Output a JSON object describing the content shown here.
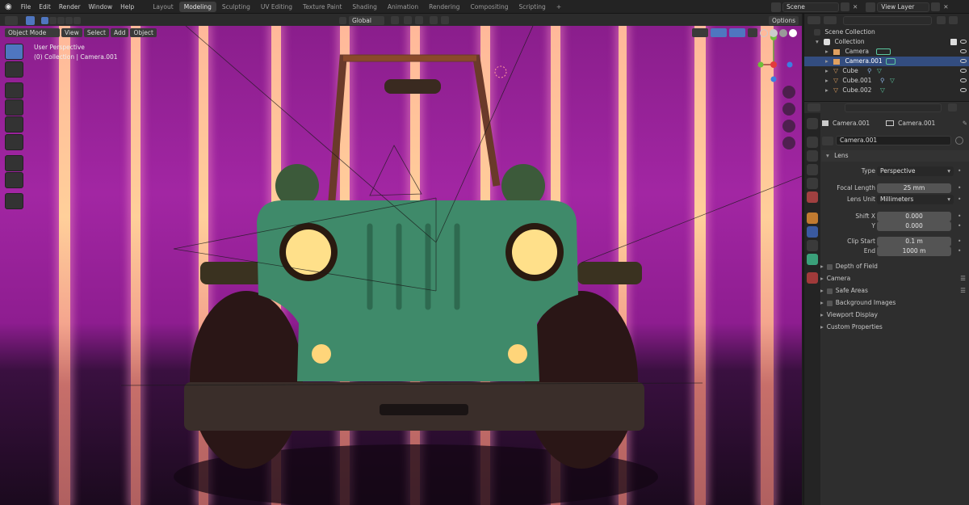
{
  "topbar": {
    "menus": [
      "File",
      "Edit",
      "Render",
      "Window",
      "Help"
    ],
    "workspaces": [
      "Layout",
      "Modeling",
      "Sculpting",
      "UV Editing",
      "Texture Paint",
      "Shading",
      "Animation",
      "Rendering",
      "Compositing",
      "Scripting"
    ],
    "active_workspace": "Modeling",
    "add_workspace": "+",
    "scene": "Scene",
    "view_layer": "View Layer"
  },
  "viewport": {
    "mode": "Object Mode",
    "menus": [
      "View",
      "Select",
      "Add",
      "Object"
    ],
    "orientation": "Global",
    "options": "Options",
    "overlay_title": "User Perspective",
    "overlay_subtitle": "(0) Collection | Camera.001"
  },
  "outliner": {
    "root": "Scene Collection",
    "collection": "Collection",
    "items": [
      {
        "name": "Camera",
        "icon": "camera-icon"
      },
      {
        "name": "Camera.001",
        "icon": "camera-icon",
        "selected": true
      },
      {
        "name": "Cube",
        "icon": "mesh-icon"
      },
      {
        "name": "Cube.001",
        "icon": "mesh-icon"
      },
      {
        "name": "Cube.002",
        "icon": "mesh-icon"
      }
    ]
  },
  "properties": {
    "breadcrumb_object": "Camera.001",
    "breadcrumb_data": "Camera.001",
    "datablock": "Camera.001",
    "lens_panel": "Lens",
    "type_label": "Type",
    "type_value": "Perspective",
    "focal_label": "Focal Length",
    "focal_value": "25 mm",
    "lens_unit_label": "Lens Unit",
    "lens_unit_value": "Millimeters",
    "shift_x_label": "Shift X",
    "shift_x_value": "0.000",
    "shift_y_label": "Y",
    "shift_y_value": "0.000",
    "clip_start_label": "Clip Start",
    "clip_start_value": "0.1 m",
    "clip_end_label": "End",
    "clip_end_value": "1000 m",
    "panels": [
      "Depth of Field",
      "Camera",
      "Safe Areas",
      "Background Images",
      "Viewport Display",
      "Custom Properties"
    ]
  },
  "colors": {
    "accent": "#4f76c0",
    "selection": "#334d80",
    "background_magenta": "#a226a3",
    "light_stripe": "#ffcf9a",
    "car_body": "#3f8a6a"
  }
}
